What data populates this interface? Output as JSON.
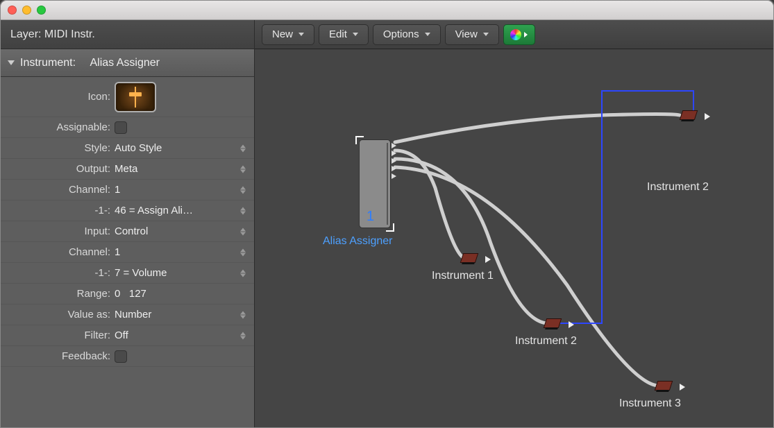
{
  "sidebar": {
    "layer_label": "Layer:",
    "layer_value": "MIDI Instr.",
    "section_label": "Instrument:",
    "section_value": "Alias Assigner",
    "props": {
      "icon_label": "Icon:",
      "assignable_label": "Assignable:",
      "assignable_checked": false,
      "style_label": "Style:",
      "style_value": "Auto Style",
      "output_label": "Output:",
      "output_value": "Meta",
      "out_channel_label": "Channel:",
      "out_channel_value": "1",
      "out_param_label": "-1-:",
      "out_param_value": "46 = Assign Ali…",
      "input_label": "Input:",
      "input_value": "Control",
      "in_channel_label": "Channel:",
      "in_channel_value": "1",
      "in_param_label": "-1-:",
      "in_param_value": "7 = Volume",
      "range_label": "Range:",
      "range_lo": "0",
      "range_hi": "127",
      "valueas_label": "Value as:",
      "valueas_value": "Number",
      "filter_label": "Filter:",
      "filter_value": "Off",
      "feedback_label": "Feedback:",
      "feedback_checked": false
    }
  },
  "toolbar": {
    "new": "New",
    "edit": "Edit",
    "options": "Options",
    "view": "View"
  },
  "canvas": {
    "fader_value": "1",
    "fader_label": "Alias Assigner",
    "inst1": "Instrument 1",
    "inst2a": "Instrument 2",
    "inst2b": "Instrument 2",
    "inst3": "Instrument 3"
  }
}
